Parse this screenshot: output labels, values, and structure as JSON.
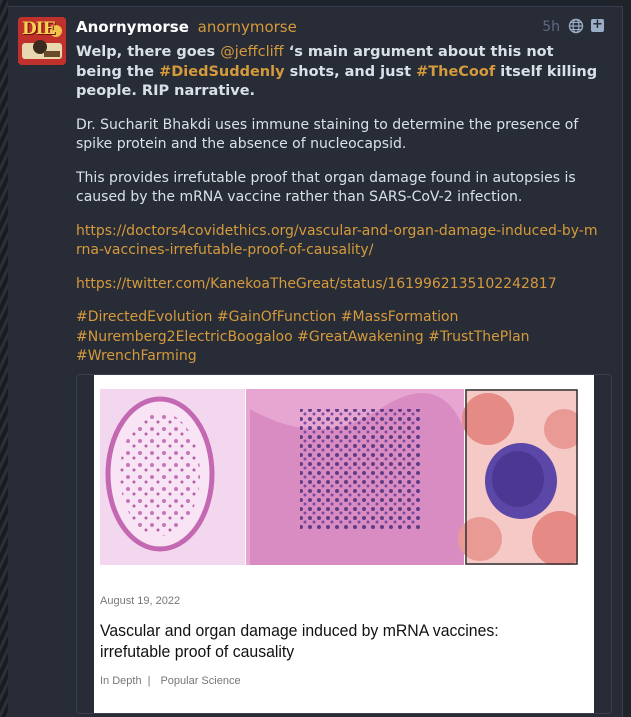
{
  "post": {
    "display_name": "Anornymorse",
    "handle": "anornymorse",
    "time": "5h",
    "avatar_text": "DIE",
    "lead": {
      "part1": "Welp, there goes ",
      "mention": "@jeffcliff",
      "part2": " ‘s main argument about this not being the ",
      "tag1": "#DiedSuddenly",
      "part3": " shots, and just ",
      "tag2": "#TheCoof",
      "part4": " itself killing people. RIP narrative."
    },
    "paragraph1": "Dr. Sucharit Bhakdi uses immune staining to determine the presence of spike protein and the absence of nucleocapsid.",
    "paragraph2": "This provides irrefutable proof that organ damage found in autopsies is caused by the mRNA vaccine rather than SARS-CoV-2 infection.",
    "link1": "https://doctors4covidethics.org/vascular-and-organ-damage-induced-by-mrna-vaccines-irrefutable-proof-of-causality/",
    "link2": "https://twitter.com/KanekoaTheGreat/status/1619962135102242817",
    "hashtags": [
      "#DirectedEvolution",
      "#GainOfFunction",
      "#MassFormation",
      "#Nuremberg2ElectricBoogaloo",
      "#GreatAwakening",
      "#TrustThePlan",
      "#WrenchFarming"
    ]
  },
  "card": {
    "date": "August 19, 2022",
    "title": "Vascular and organ damage induced by mRNA vaccines: irrefutable proof of causality",
    "category": "In Depth",
    "separator": "|",
    "section": "Popular Science"
  },
  "colors": {
    "background": "#282c37",
    "accent": "#d59a3b",
    "text": "#d9e1e8",
    "muted": "#606984"
  },
  "icons": [
    "globe-icon",
    "expand-icon"
  ]
}
